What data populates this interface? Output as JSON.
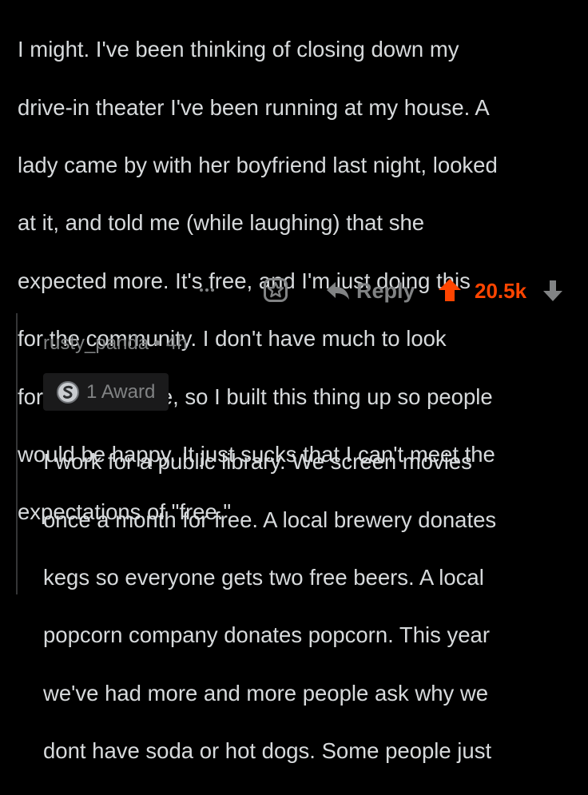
{
  "parent_comment": {
    "text_lines": [
      "I might. I've been thinking of closing down my",
      "drive-in theater I've been running at my house. A",
      "lady came by with her boyfriend last night, looked",
      "at it, and told me (while laughing) that she",
      "expected more. It's free, and I'm just doing this",
      "for the community. I don't have much to look",
      "forward to in life, so I built this thing up so people",
      "would be happy. It just sucks that I can't meet the",
      "expectations of \"free.\""
    ],
    "actions": {
      "more_icon": "more-dots-icon",
      "award_icon": "award-icon",
      "reply_label": "Reply",
      "score": "20.5k",
      "upvote_color": "#ff4500"
    }
  },
  "reply": {
    "username": "rusty_panda",
    "separator": "•",
    "age": "4h",
    "award_label": "1 Award",
    "text_lines": [
      "I work for a public library. We screen movies",
      "once a month for free. A local brewery donates",
      "kegs so everyone gets two free beers. A local",
      "popcorn company donates popcorn. This year",
      "we've had more and more people ask why we",
      "dont have soda or hot dogs. Some people just"
    ]
  },
  "colors": {
    "background": "#000000",
    "text": "#d7dadc",
    "muted": "#818384",
    "accent": "#ff4500"
  }
}
